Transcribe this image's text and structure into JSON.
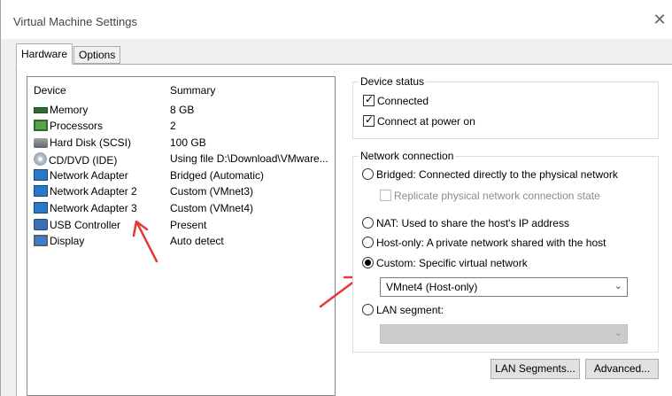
{
  "window": {
    "title": "Virtual Machine Settings",
    "close_glyph": "✕"
  },
  "tabs": [
    {
      "label": "Hardware",
      "active": true
    },
    {
      "label": "Options",
      "active": false
    }
  ],
  "device_list": {
    "columns": {
      "device": "Device",
      "summary": "Summary"
    },
    "rows": [
      {
        "icon": "memory-icon",
        "name": "Memory",
        "summary": "8 GB"
      },
      {
        "icon": "processor-icon",
        "name": "Processors",
        "summary": "2"
      },
      {
        "icon": "hard-disk-icon",
        "name": "Hard Disk (SCSI)",
        "summary": "100 GB"
      },
      {
        "icon": "cd-dvd-icon",
        "name": "CD/DVD (IDE)",
        "summary": "Using file D:\\Download\\VMware..."
      },
      {
        "icon": "network-adapter-icon",
        "name": "Network Adapter",
        "summary": "Bridged (Automatic)"
      },
      {
        "icon": "network-adapter-icon",
        "name": "Network Adapter 2",
        "summary": "Custom (VMnet3)"
      },
      {
        "icon": "network-adapter-icon",
        "name": "Network Adapter 3",
        "summary": "Custom (VMnet4)"
      },
      {
        "icon": "usb-controller-icon",
        "name": "USB Controller",
        "summary": "Present"
      },
      {
        "icon": "display-icon",
        "name": "Display",
        "summary": "Auto detect"
      }
    ]
  },
  "device_status": {
    "legend": "Device status",
    "connected": {
      "label": "Connected",
      "checked": true
    },
    "connect_at_power_on": {
      "label": "Connect at power on",
      "checked": true
    }
  },
  "network_connection": {
    "legend": "Network connection",
    "bridged": {
      "label": "Bridged: Connected directly to the physical network",
      "selected": false
    },
    "replicate": {
      "label": "Replicate physical network connection state",
      "checked": false,
      "enabled": false
    },
    "nat": {
      "label": "NAT: Used to share the host's IP address",
      "selected": false
    },
    "host_only": {
      "label": "Host-only: A private network shared with the host",
      "selected": false
    },
    "custom": {
      "label": "Custom: Specific virtual network",
      "selected": true
    },
    "custom_select_value": "VMnet4 (Host-only)",
    "lan_segment": {
      "label": "LAN segment:",
      "selected": false
    },
    "lan_segment_select_value": ""
  },
  "buttons": {
    "lan_segments": "LAN Segments...",
    "advanced": "Advanced..."
  },
  "colors": {
    "arrow": "#e53935",
    "accent": "#0078d7"
  }
}
